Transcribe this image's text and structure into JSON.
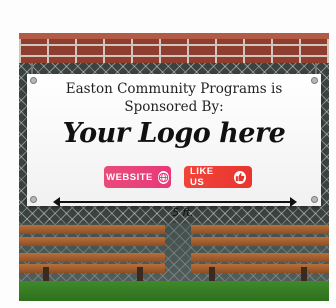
{
  "banner": {
    "line1": "Easton Community Programs is",
    "line2": "Sponsored By:",
    "logo_text": "Your Logo here",
    "website_label": "WEBSITE",
    "like_label": "LIKE US",
    "website_icon": "globe-icon",
    "like_icon": "thumbs-up-icon"
  },
  "dimension": {
    "label": "5 ft."
  },
  "colors": {
    "website_button": "#e8397a",
    "like_button": "#e8352f",
    "brick": "#8e3d2e",
    "grass": "#3f8a2a"
  }
}
